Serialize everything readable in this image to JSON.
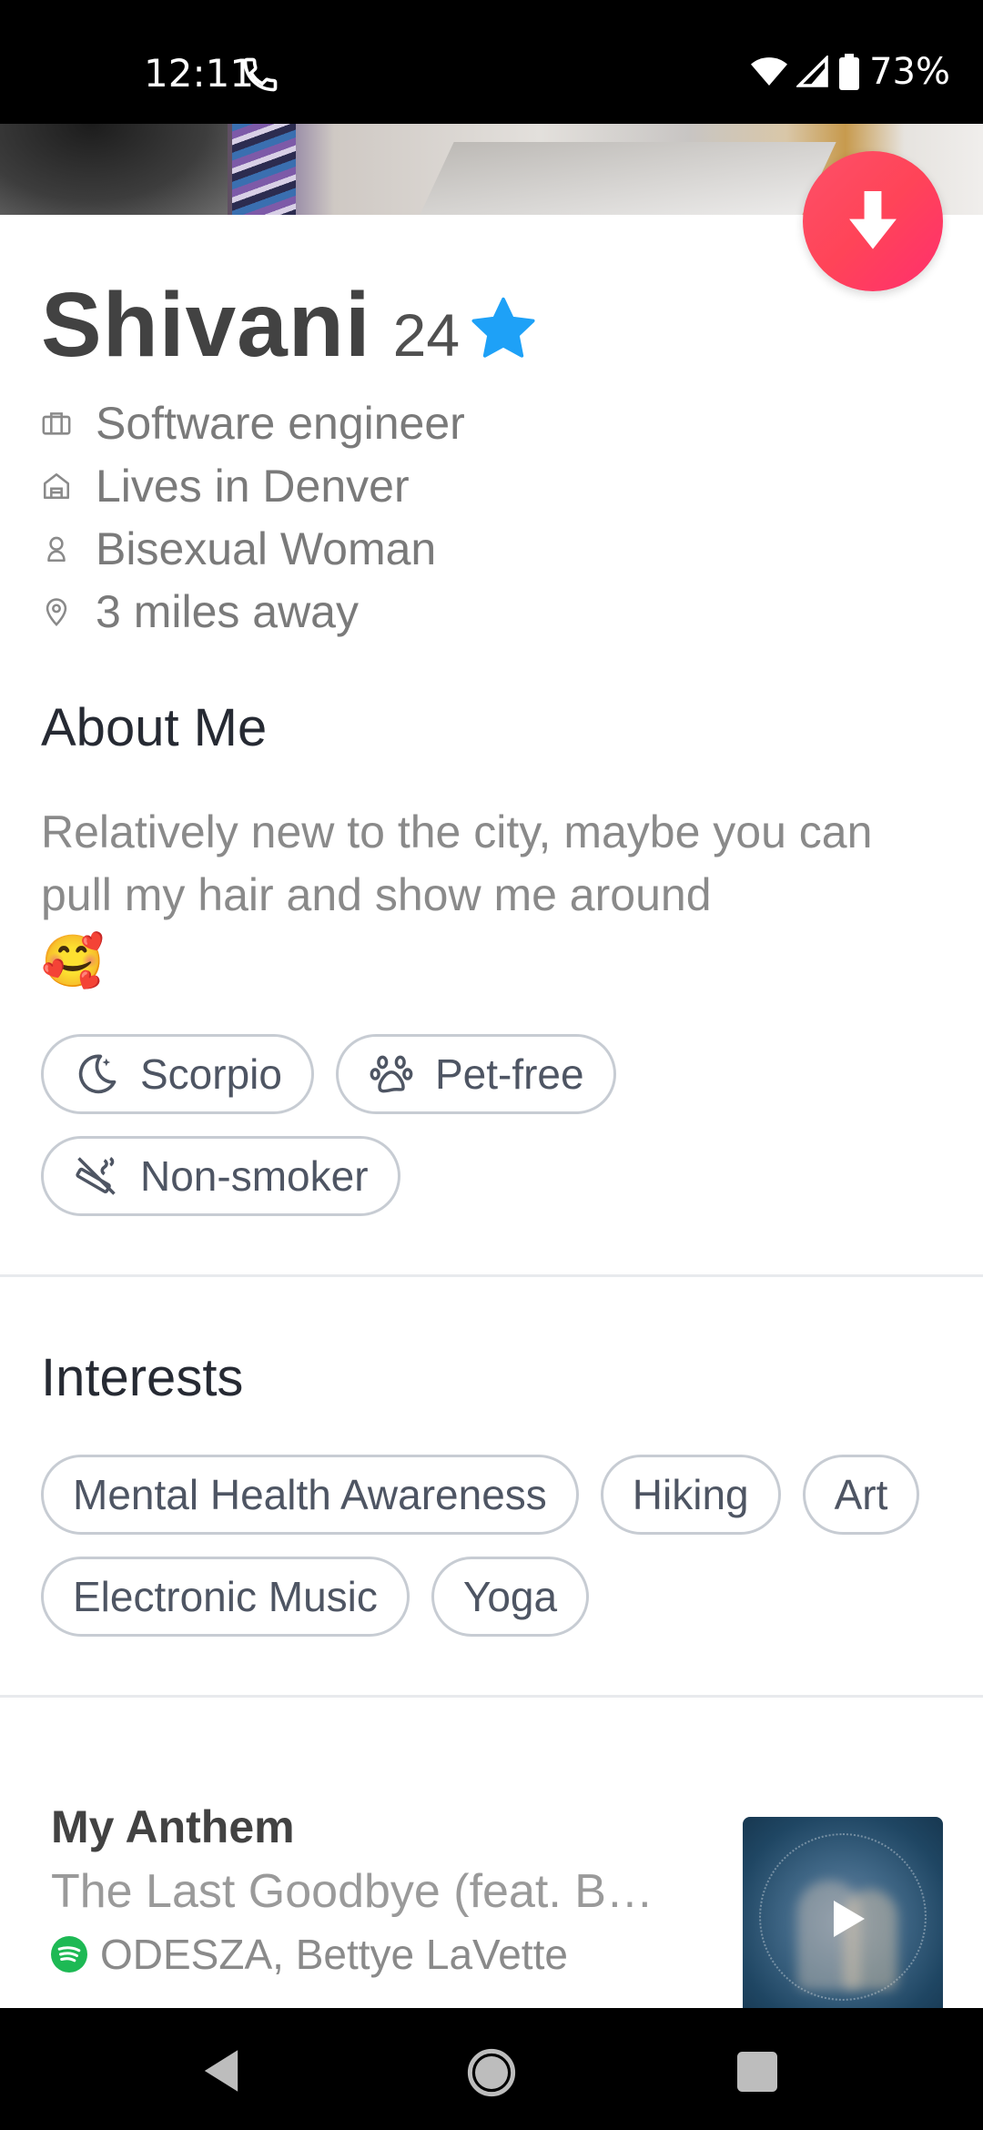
{
  "status_bar": {
    "time": "12:11",
    "battery_pct": "73%"
  },
  "profile": {
    "name": "Shivani",
    "age": "24",
    "verified_color": "#1ea1f7",
    "info": [
      {
        "icon": "briefcase-icon",
        "text": "Software engineer"
      },
      {
        "icon": "home-icon",
        "text": "Lives in Denver"
      },
      {
        "icon": "person-icon",
        "text": "Bisexual Woman"
      },
      {
        "icon": "location-pin-icon",
        "text": "3 miles away"
      }
    ]
  },
  "about": {
    "heading": "About Me",
    "text": "Relatively new to the city, maybe you can pull my hair and show me around",
    "emoji": "🥰",
    "chips": [
      {
        "icon": "moon-icon",
        "label": "Scorpio"
      },
      {
        "icon": "paw-icon",
        "label": "Pet-free"
      },
      {
        "icon": "no-smoking-icon",
        "label": "Non-smoker"
      }
    ]
  },
  "interests": {
    "heading": "Interests",
    "chips": [
      "Mental Health Awareness",
      "Hiking",
      "Art",
      "Electronic Music",
      "Yoga"
    ]
  },
  "anthem": {
    "heading": "My Anthem",
    "song": "The Last Goodbye (feat. B…",
    "artist": "ODESZA, Bettye LaVette",
    "spotify_color": "#1db954"
  },
  "colors": {
    "accent": "#ff4458",
    "chip_border": "#c7ccd3"
  }
}
